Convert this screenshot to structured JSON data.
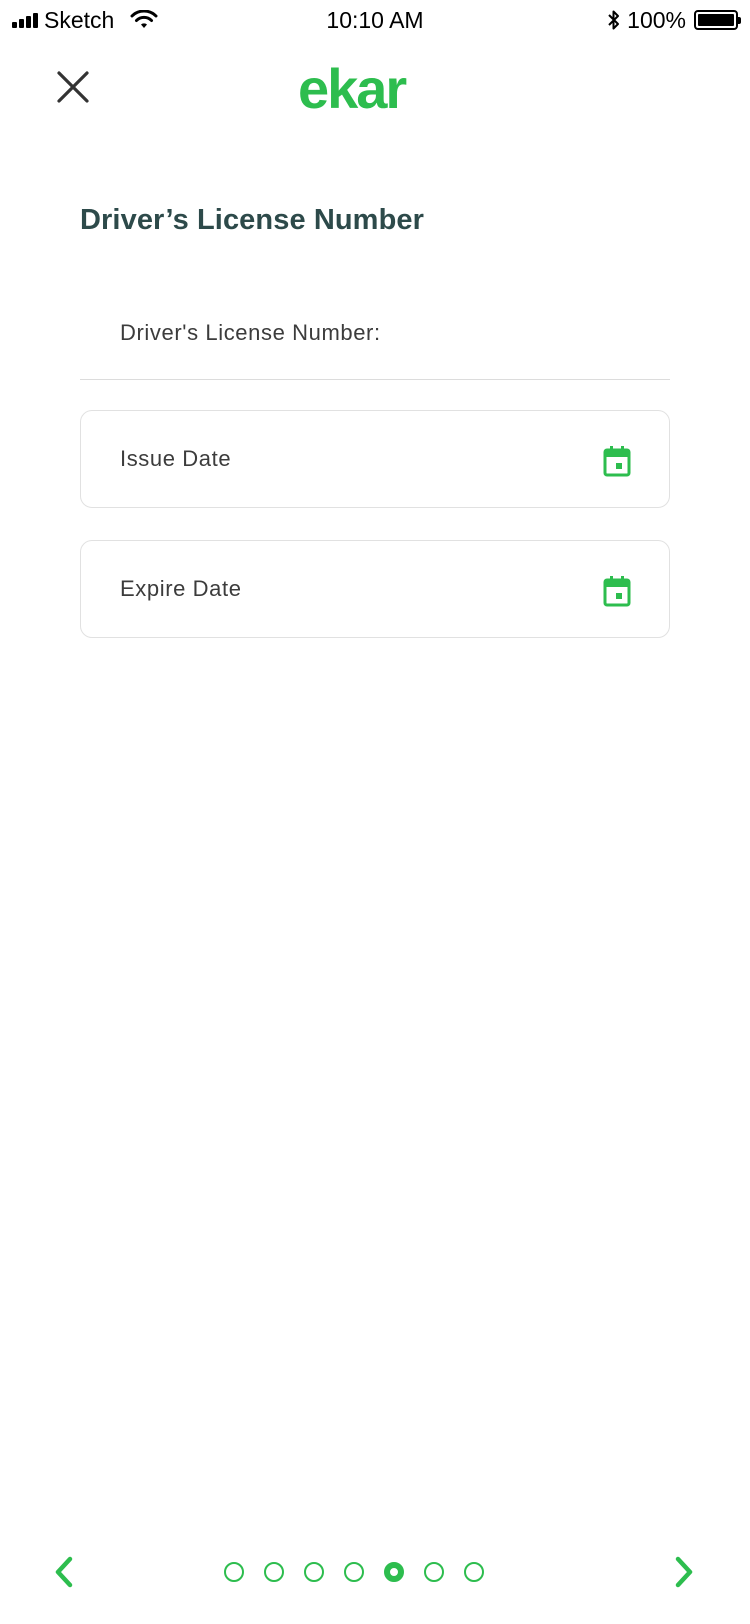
{
  "status_bar": {
    "carrier": "Sketch",
    "time": "10:10 AM",
    "battery": "100%"
  },
  "header": {
    "logo_text": "ekar",
    "close_icon": "close-icon"
  },
  "page_title": "Driver’s License Number",
  "form": {
    "license_label": "Driver's License Number:",
    "issue_date_label": "Issue Date",
    "expire_date_label": "Expire Date",
    "date_icon": "calendar-icon"
  },
  "pagination": {
    "total_steps": 7,
    "current_step": 5,
    "prev_icon": "chevron-left-icon",
    "next_icon": "chevron-right-icon"
  },
  "colors": {
    "accent": "#2dbd4e",
    "title": "#2d4a4a",
    "text": "#3c3c3c",
    "border": "#e1e1e1"
  }
}
